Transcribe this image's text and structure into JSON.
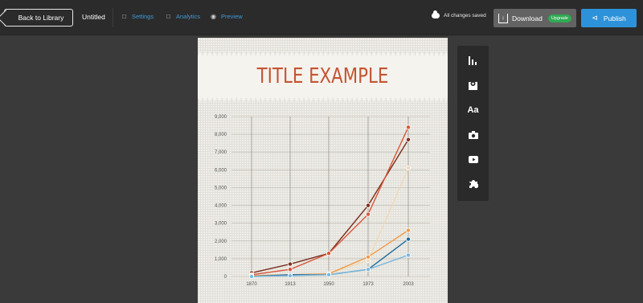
{
  "topbar": {
    "back_label": "Back to Library",
    "doc_title": "Untitled",
    "nav": [
      {
        "label": "Settings",
        "icon": "document-gear-icon"
      },
      {
        "label": "Analytics",
        "icon": "document-chart-icon"
      },
      {
        "label": "Preview",
        "icon": "eye-icon"
      }
    ],
    "save_status": "All changes saved",
    "download_label": "Download",
    "upgrade_label": "Upgrade",
    "publish_label": "Publish"
  },
  "canvas": {
    "title": "TITLE EXAMPLE"
  },
  "side_toolbar": [
    "chart-icon",
    "map-icon",
    "text-icon",
    "camera-icon",
    "video-icon",
    "puzzle-icon"
  ],
  "side_toolbar_text": {
    "text_tool": "Aa"
  },
  "chart_data": {
    "type": "line",
    "x": [
      1870,
      1913,
      1950,
      1973,
      2003
    ],
    "ylim": [
      0,
      9000
    ],
    "yticks": [
      "0",
      "1,000",
      "2,000",
      "3,000",
      "4,000",
      "5,000",
      "6,000",
      "7,000",
      "8,000",
      "9,000"
    ],
    "yvalues": [
      0,
      1000,
      2000,
      3000,
      4000,
      5000,
      6000,
      7000,
      8000,
      9000
    ],
    "xticks": [
      "1870",
      "1913",
      "1950",
      "1973",
      "2003"
    ],
    "grid": true,
    "series": [
      {
        "color": "#7a2e1e",
        "values": [
          200,
          700,
          1300,
          4000,
          7700
        ]
      },
      {
        "color": "#d9553a",
        "values": [
          100,
          400,
          1300,
          3500,
          8400
        ]
      },
      {
        "color": "#f0d9b8",
        "values": [
          50,
          100,
          150,
          900,
          6100
        ]
      },
      {
        "color": "#ef9a4a",
        "values": [
          50,
          100,
          150,
          1100,
          2600
        ]
      },
      {
        "color": "#1f6d9e",
        "values": [
          0,
          100,
          100,
          400,
          2100
        ]
      },
      {
        "color": "#7ab8de",
        "values": [
          0,
          50,
          100,
          400,
          1200
        ]
      }
    ]
  }
}
